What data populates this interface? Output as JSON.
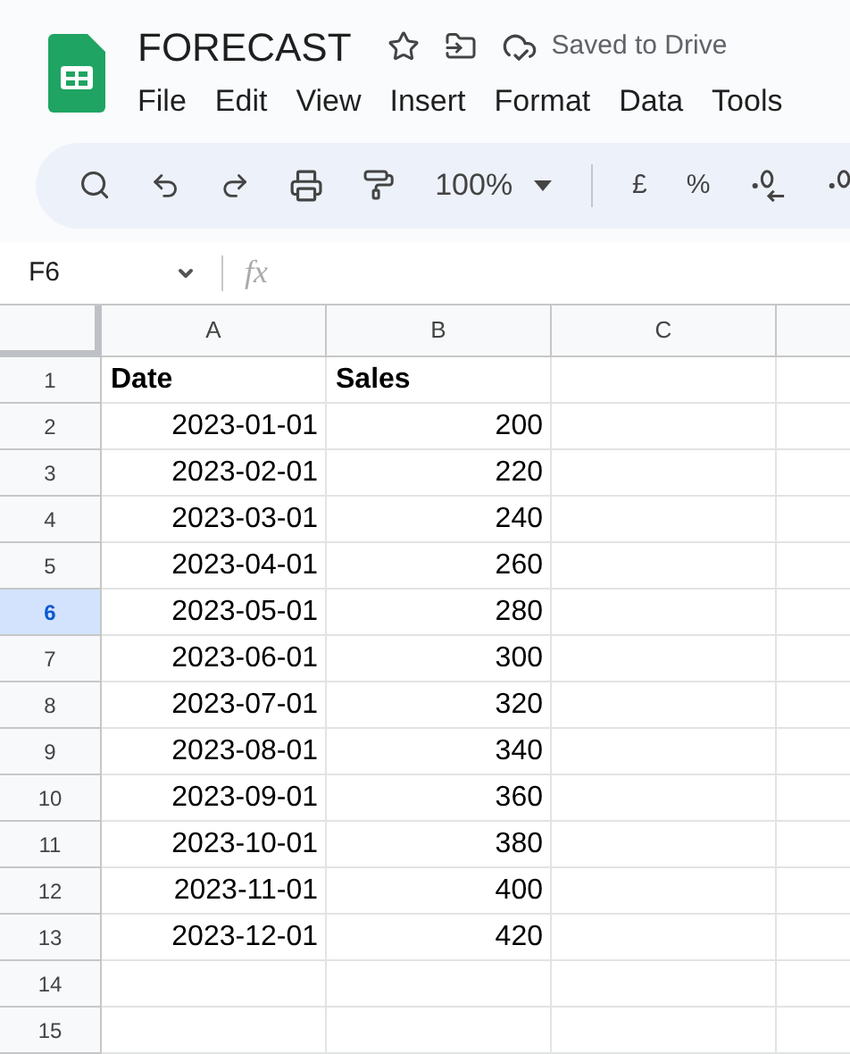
{
  "document": {
    "title": "FORECAST",
    "save_status": "Saved to Drive"
  },
  "menu": [
    "File",
    "Edit",
    "View",
    "Insert",
    "Format",
    "Data",
    "Tools"
  ],
  "toolbar": {
    "zoom": "100%",
    "currency": "£",
    "percent": "%"
  },
  "formula_bar": {
    "name_box": "F6",
    "fx": "fx"
  },
  "columns": [
    {
      "label": "A",
      "selected": false
    },
    {
      "label": "B",
      "selected": false
    },
    {
      "label": "C",
      "selected": false
    }
  ],
  "rows": [
    {
      "number": "1",
      "selected": false,
      "cells": [
        {
          "text": "Date",
          "kind": "header"
        },
        {
          "text": "Sales",
          "kind": "header"
        }
      ]
    },
    {
      "number": "2",
      "selected": false,
      "cells": [
        {
          "text": "2023-01-01",
          "kind": "value"
        },
        {
          "text": "200",
          "kind": "value"
        }
      ]
    },
    {
      "number": "3",
      "selected": false,
      "cells": [
        {
          "text": "2023-02-01",
          "kind": "value"
        },
        {
          "text": "220",
          "kind": "value"
        }
      ]
    },
    {
      "number": "4",
      "selected": false,
      "cells": [
        {
          "text": "2023-03-01",
          "kind": "value"
        },
        {
          "text": "240",
          "kind": "value"
        }
      ]
    },
    {
      "number": "5",
      "selected": false,
      "cells": [
        {
          "text": "2023-04-01",
          "kind": "value"
        },
        {
          "text": "260",
          "kind": "value"
        }
      ]
    },
    {
      "number": "6",
      "selected": true,
      "cells": [
        {
          "text": "2023-05-01",
          "kind": "value"
        },
        {
          "text": "280",
          "kind": "value"
        }
      ]
    },
    {
      "number": "7",
      "selected": false,
      "cells": [
        {
          "text": "2023-06-01",
          "kind": "value"
        },
        {
          "text": "300",
          "kind": "value"
        }
      ]
    },
    {
      "number": "8",
      "selected": false,
      "cells": [
        {
          "text": "2023-07-01",
          "kind": "value"
        },
        {
          "text": "320",
          "kind": "value"
        }
      ]
    },
    {
      "number": "9",
      "selected": false,
      "cells": [
        {
          "text": "2023-08-01",
          "kind": "value"
        },
        {
          "text": "340",
          "kind": "value"
        }
      ]
    },
    {
      "number": "10",
      "selected": false,
      "cells": [
        {
          "text": "2023-09-01",
          "kind": "value"
        },
        {
          "text": "360",
          "kind": "value"
        }
      ]
    },
    {
      "number": "11",
      "selected": false,
      "cells": [
        {
          "text": "2023-10-01",
          "kind": "value"
        },
        {
          "text": "380",
          "kind": "value"
        }
      ]
    },
    {
      "number": "12",
      "selected": false,
      "cells": [
        {
          "text": "2023-11-01",
          "kind": "value"
        },
        {
          "text": "400",
          "kind": "value"
        }
      ]
    },
    {
      "number": "13",
      "selected": false,
      "cells": [
        {
          "text": "2023-12-01",
          "kind": "value"
        },
        {
          "text": "420",
          "kind": "value"
        }
      ]
    },
    {
      "number": "14",
      "selected": false,
      "cells": []
    },
    {
      "number": "15",
      "selected": false,
      "cells": []
    }
  ]
}
